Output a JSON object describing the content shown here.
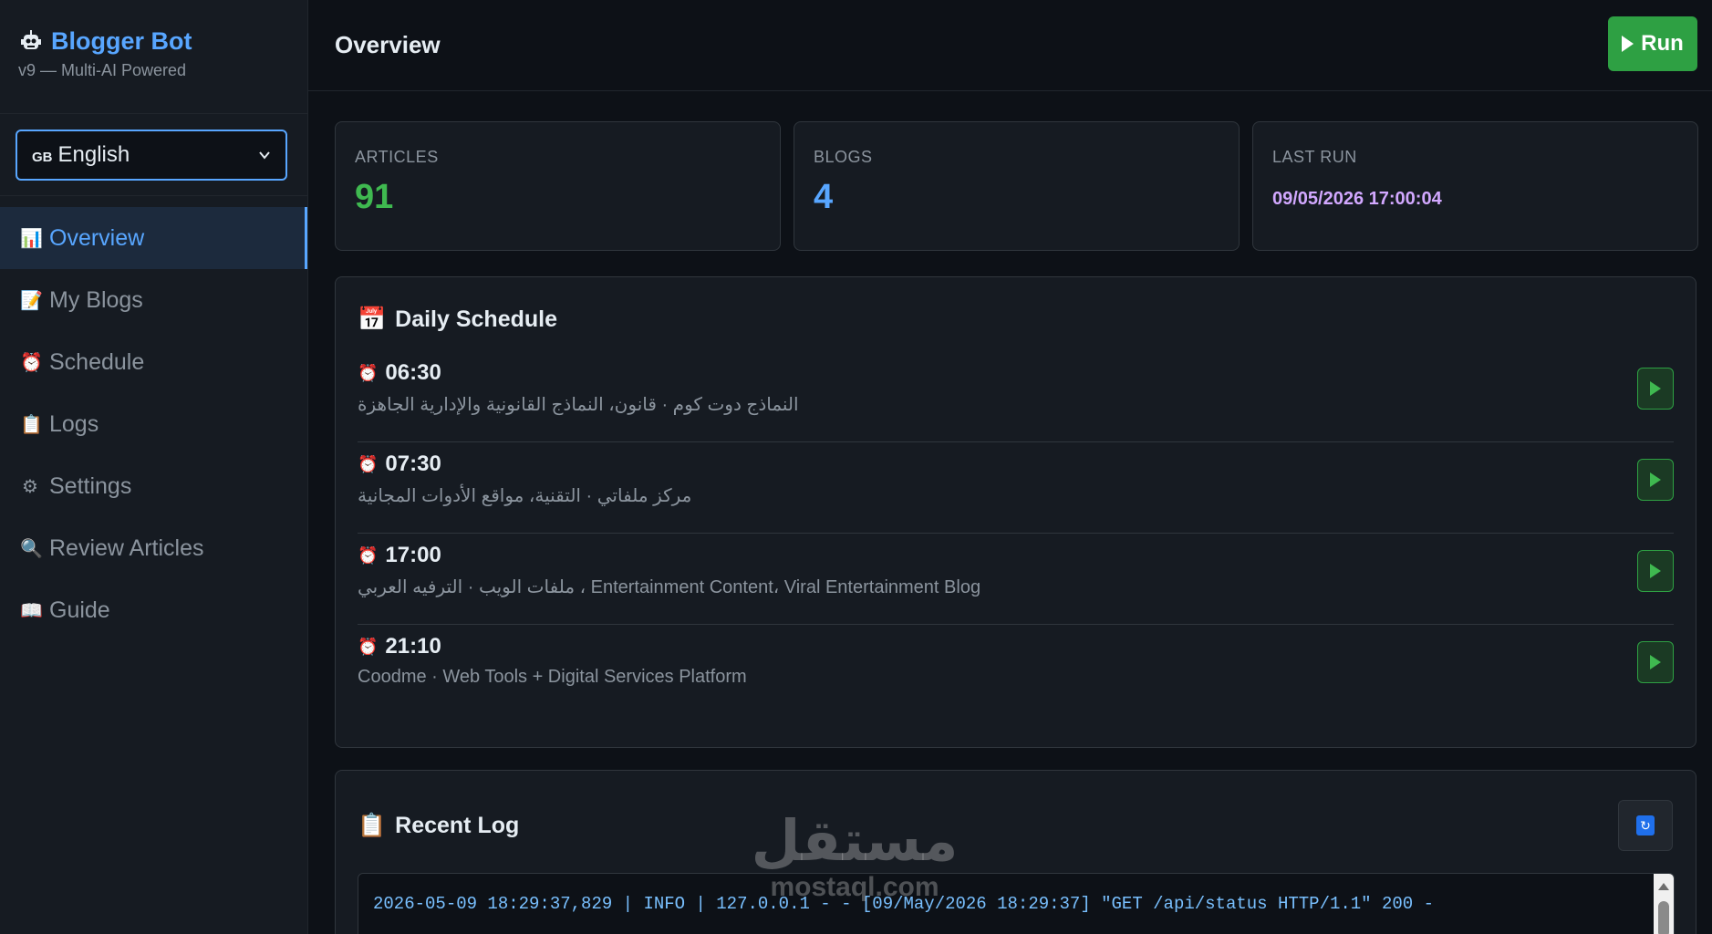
{
  "app": {
    "name": "Blogger Bot",
    "subtitle": "v9 — Multi-AI Powered"
  },
  "language": {
    "flag": "GB",
    "selected": "English"
  },
  "nav": [
    {
      "label": "Overview",
      "icon": "📊",
      "icon_name": "bar-chart-icon",
      "active": true
    },
    {
      "label": "My Blogs",
      "icon": "📝",
      "icon_name": "memo-icon",
      "active": false
    },
    {
      "label": "Schedule",
      "icon": "⏰",
      "icon_name": "alarm-clock-icon",
      "active": false
    },
    {
      "label": "Logs",
      "icon": "📋",
      "icon_name": "clipboard-icon",
      "active": false
    },
    {
      "label": "Settings",
      "icon": "⚙",
      "icon_name": "gear-icon",
      "active": false
    },
    {
      "label": "Review Articles",
      "icon": "🔍",
      "icon_name": "magnifier-icon",
      "active": false
    },
    {
      "label": "Guide",
      "icon": "📖",
      "icon_name": "book-icon",
      "active": false
    }
  ],
  "header": {
    "title": "Overview",
    "run_label": "Run"
  },
  "stats": [
    {
      "label": "ARTICLES",
      "value": "91",
      "color": "#3fb950"
    },
    {
      "label": "BLOGS",
      "value": "4",
      "color": "#58a6ff"
    },
    {
      "label": "LAST RUN",
      "value": "09/05/2026 17:00:04",
      "color": "#d2a8ff"
    }
  ],
  "schedule": {
    "title": "Daily Schedule",
    "items": [
      {
        "time": "06:30",
        "desc": "النماذج دوت كوم · قانون، النماذج القانونية والإدارية الجاهزة"
      },
      {
        "time": "07:30",
        "desc": "مركز ملفاتي · التقنية، مواقع الأدوات المجانية"
      },
      {
        "time": "17:00",
        "desc": "ملفات الويب · الترفيه العربي ، Entertainment Content، Viral Entertainment Blog"
      },
      {
        "time": "21:10",
        "desc": "Coodme · Web Tools + Digital Services Platform"
      }
    ]
  },
  "log": {
    "title": "Recent Log",
    "lines": [
      "2026-05-09 18:29:37,829 | INFO | 127.0.0.1 - - [09/May/2026 18:29:37] \"GET /api/status HTTP/1.1\" 200 -"
    ]
  },
  "watermark": {
    "arabic": "مستقل",
    "latin": "mostaql.com"
  }
}
